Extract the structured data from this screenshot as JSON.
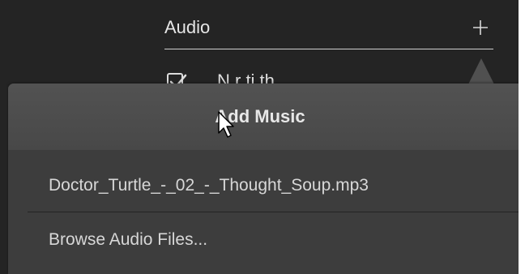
{
  "audio_section": {
    "title": "Audio",
    "add_icon": "plus-icon",
    "narration_label_partial": "N      r  ti            th"
  },
  "popup": {
    "title": "Add Music",
    "items": [
      {
        "label": "Doctor_Turtle_-_02_-_Thought_Soup.mp3"
      },
      {
        "label": "Browse Audio Files..."
      }
    ]
  },
  "cursor": {
    "icon": "mouse-pointer-icon"
  },
  "colors": {
    "panel_background": "#242424",
    "popup_background": "#3d3d3d",
    "popup_header": "#525252",
    "text": "#d7d7d7",
    "divider": "#cfcfcf"
  }
}
